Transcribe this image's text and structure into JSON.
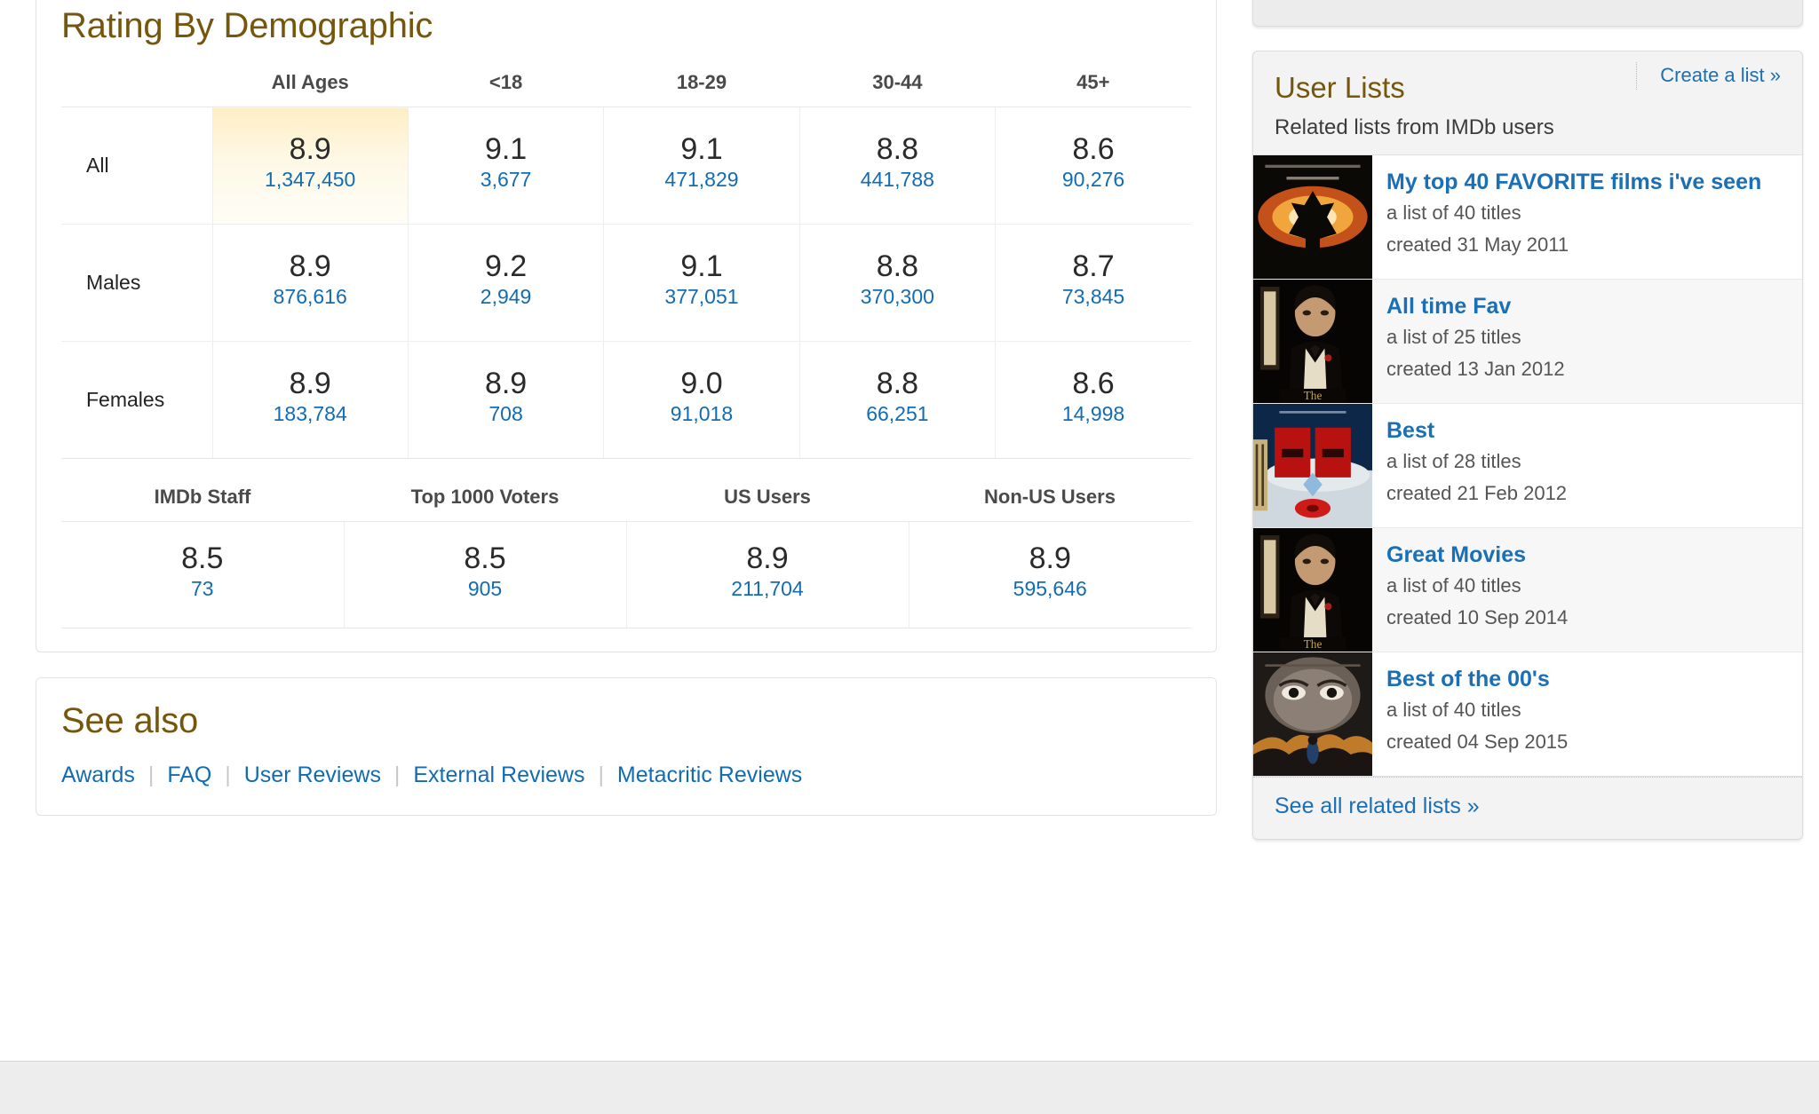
{
  "colors": {
    "heading": "#74570c",
    "link": "#136cb2",
    "list_link": "#1a6fb5",
    "highlight_cell": "#fdeec5",
    "footer_bar": "#ededed"
  },
  "ratings_panel": {
    "title": "Rating By Demographic",
    "demographic_table": {
      "column_headers": [
        "All Ages",
        "<18",
        "18-29",
        "30-44",
        "45+"
      ],
      "rows": [
        {
          "label": "All",
          "cells": [
            {
              "rating": "8.9",
              "votes": "1,347,450",
              "highlight": true
            },
            {
              "rating": "9.1",
              "votes": "3,677",
              "highlight": false
            },
            {
              "rating": "9.1",
              "votes": "471,829",
              "highlight": false
            },
            {
              "rating": "8.8",
              "votes": "441,788",
              "highlight": false
            },
            {
              "rating": "8.6",
              "votes": "90,276",
              "highlight": false
            }
          ]
        },
        {
          "label": "Males",
          "cells": [
            {
              "rating": "8.9",
              "votes": "876,616",
              "highlight": false
            },
            {
              "rating": "9.2",
              "votes": "2,949",
              "highlight": false
            },
            {
              "rating": "9.1",
              "votes": "377,051",
              "highlight": false
            },
            {
              "rating": "8.8",
              "votes": "370,300",
              "highlight": false
            },
            {
              "rating": "8.7",
              "votes": "73,845",
              "highlight": false
            }
          ]
        },
        {
          "label": "Females",
          "cells": [
            {
              "rating": "8.9",
              "votes": "183,784",
              "highlight": false
            },
            {
              "rating": "8.9",
              "votes": "708",
              "highlight": false
            },
            {
              "rating": "9.0",
              "votes": "91,018",
              "highlight": false
            },
            {
              "rating": "8.8",
              "votes": "66,251",
              "highlight": false
            },
            {
              "rating": "8.6",
              "votes": "14,998",
              "highlight": false
            }
          ]
        }
      ]
    },
    "source_table": {
      "column_headers": [
        "IMDb Staff",
        "Top 1000 Voters",
        "US Users",
        "Non-US Users"
      ],
      "cells": [
        {
          "rating": "8.5",
          "votes": "73"
        },
        {
          "rating": "8.5",
          "votes": "905"
        },
        {
          "rating": "8.9",
          "votes": "211,704"
        },
        {
          "rating": "8.9",
          "votes": "595,646"
        }
      ]
    }
  },
  "see_also": {
    "title": "See also",
    "links": [
      "Awards",
      "FAQ",
      "User Reviews",
      "External Reviews",
      "Metacritic Reviews"
    ],
    "separator": "|"
  },
  "user_lists": {
    "title": "User Lists",
    "subtitle": "Related lists from IMDb users",
    "create_link": "Create a list »",
    "footer_link": "See all related lists »",
    "items": [
      {
        "title": "My top 40 FAVORITE films i've seen",
        "count": "a list of 40 titles",
        "created": "created 31 May 2011",
        "poster": "dark-knight-poster"
      },
      {
        "title": "All time Fav",
        "count": "a list of 25 titles",
        "created": "created 13 Jan 2012",
        "poster": "godfather-poster"
      },
      {
        "title": "Best",
        "count": "a list of 28 titles",
        "created": "created 21 Feb 2012",
        "poster": "red-curtain-poster"
      },
      {
        "title": "Great Movies",
        "count": "a list of 40 titles",
        "created": "created 10 Sep 2014",
        "poster": "godfather-poster"
      },
      {
        "title": "Best of the 00's",
        "count": "a list of 40 titles",
        "created": "created 04 Sep 2015",
        "poster": "eyes-poster"
      }
    ]
  }
}
